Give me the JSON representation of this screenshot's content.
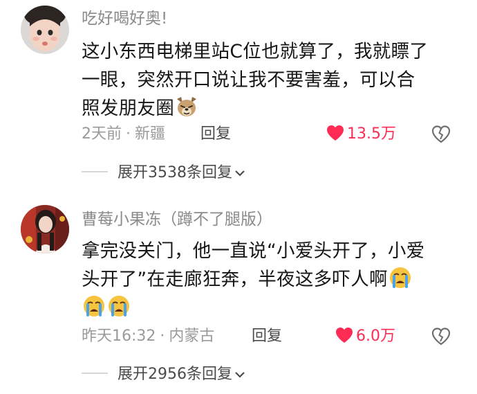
{
  "comments": [
    {
      "username": "吃好喝好奥!",
      "lines": [
        "这小东西电梯里站C位也就算了，我就瞟了",
        "一眼，突然开口说让我不要害羞，可以合",
        "照发朋友圈"
      ],
      "emoji_after": "dog-face-emoji",
      "time": "2天前",
      "location": "新疆",
      "reply_label": "回复",
      "likes": "13.5万",
      "expand_label": "展开3538条回复"
    },
    {
      "username": "曹莓小果冻（蹲不了腿版）",
      "lines": [
        "拿完没关门，他一直说“小爱头开了，小爱",
        "头开了”在走廊狂奔，半夜这多吓人啊",
        ""
      ],
      "emoji_after": "crying-face-emoji",
      "time": "昨天16:32",
      "location": "内蒙古",
      "reply_label": "回复",
      "likes": "6.0万",
      "expand_label": "展开2956条回复"
    }
  ],
  "separator": "·",
  "colors": {
    "like": "#fe2c55",
    "meta": "#9a9a9a",
    "username": "#8a8a8a",
    "text": "#161616"
  }
}
